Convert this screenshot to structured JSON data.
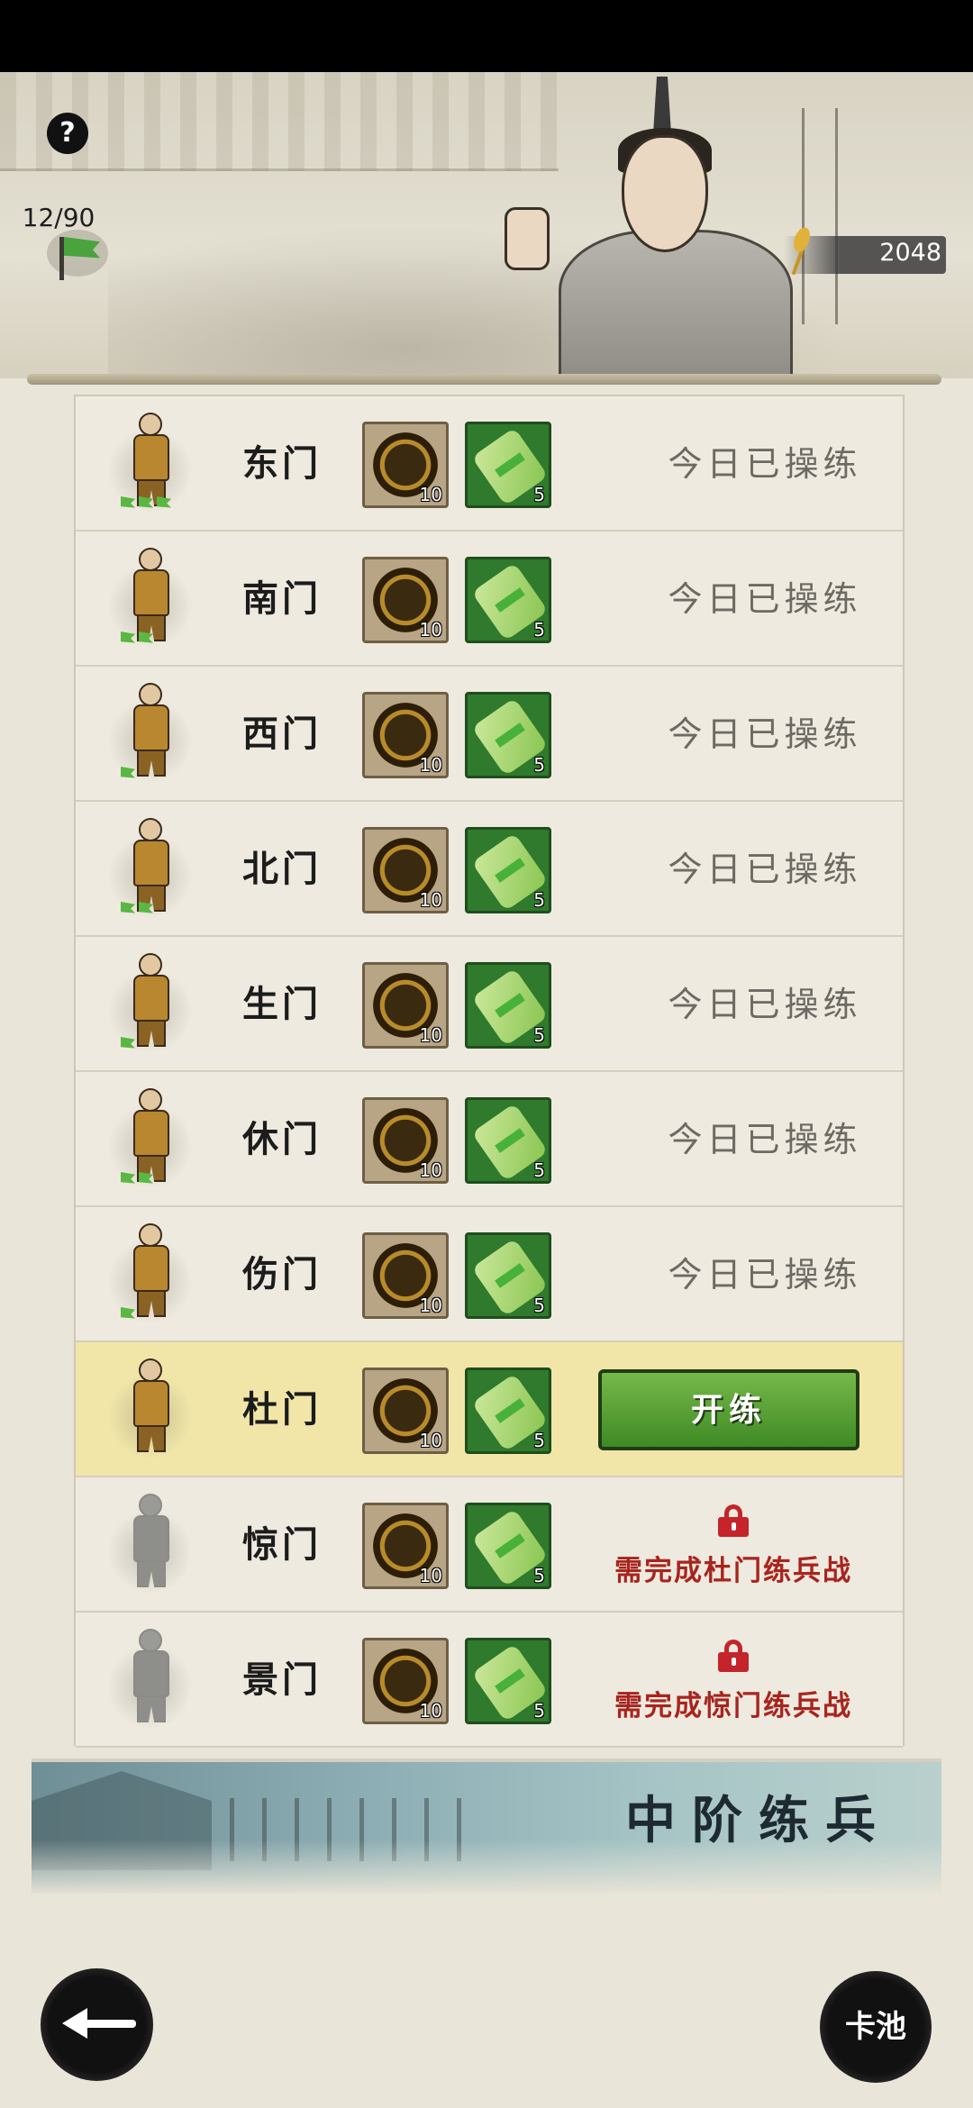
{
  "header": {
    "help_label": "?",
    "stamina": "12/90",
    "grain": "2048"
  },
  "rows": [
    {
      "gate": "东门",
      "coin_cost": "10",
      "scroll_cost": "5",
      "status": "今日已操练",
      "state": "done"
    },
    {
      "gate": "南门",
      "coin_cost": "10",
      "scroll_cost": "5",
      "status": "今日已操练",
      "state": "done"
    },
    {
      "gate": "西门",
      "coin_cost": "10",
      "scroll_cost": "5",
      "status": "今日已操练",
      "state": "done"
    },
    {
      "gate": "北门",
      "coin_cost": "10",
      "scroll_cost": "5",
      "status": "今日已操练",
      "state": "done"
    },
    {
      "gate": "生门",
      "coin_cost": "10",
      "scroll_cost": "5",
      "status": "今日已操练",
      "state": "done"
    },
    {
      "gate": "休门",
      "coin_cost": "10",
      "scroll_cost": "5",
      "status": "今日已操练",
      "state": "done"
    },
    {
      "gate": "伤门",
      "coin_cost": "10",
      "scroll_cost": "5",
      "status": "今日已操练",
      "state": "done"
    },
    {
      "gate": "杜门",
      "coin_cost": "10",
      "scroll_cost": "5",
      "button": "开练",
      "state": "available"
    },
    {
      "gate": "惊门",
      "coin_cost": "10",
      "scroll_cost": "5",
      "lock_text": "需完成杜门练兵战",
      "state": "locked"
    },
    {
      "gate": "景门",
      "coin_cost": "10",
      "scroll_cost": "5",
      "lock_text": "需完成惊门练兵战",
      "state": "locked"
    }
  ],
  "banner": {
    "title": "中阶练兵"
  },
  "footer": {
    "card_pool_label": "卡池"
  },
  "icons": {
    "help": "question-icon",
    "stamina": "green-flag-icon",
    "grain": "grain-icon",
    "coin": "bronze-coin-icon",
    "scroll": "scroll-icon",
    "lock": "lock-icon",
    "back": "back-arrow-icon"
  },
  "colors": {
    "active_row": "#f1e6a8",
    "train_button": "#4f9a30",
    "lock_red": "#c4242a"
  }
}
